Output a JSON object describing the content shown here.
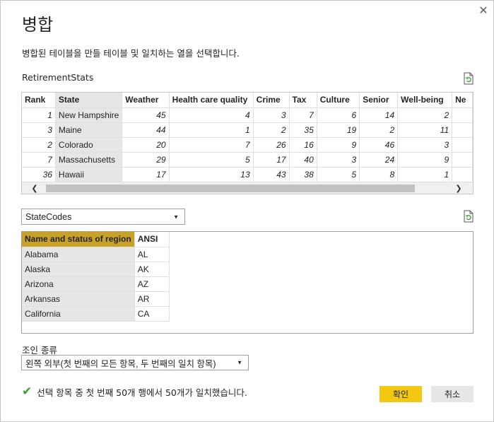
{
  "dialog": {
    "title": "병합",
    "subtitle": "병합된 테이블을 만들 테이블 및 일치하는 열을 선택합니다.",
    "close_glyph": "✕"
  },
  "table1": {
    "name": "RetirementStats",
    "columns": [
      "Rank",
      "State",
      "Weather",
      "Health care quality",
      "Crime",
      "Tax",
      "Culture",
      "Senior",
      "Well-being",
      "Ne"
    ],
    "rows": [
      [
        "1",
        "New Hampshire",
        "45",
        "4",
        "3",
        "7",
        "6",
        "14",
        "2",
        ""
      ],
      [
        "3",
        "Maine",
        "44",
        "1",
        "2",
        "35",
        "19",
        "2",
        "11",
        ""
      ],
      [
        "2",
        "Colorado",
        "20",
        "7",
        "26",
        "16",
        "9",
        "46",
        "3",
        ""
      ],
      [
        "7",
        "Massachusetts",
        "29",
        "5",
        "17",
        "40",
        "3",
        "24",
        "9",
        ""
      ],
      [
        "36",
        "Hawaii",
        "17",
        "13",
        "43",
        "38",
        "5",
        "8",
        "1",
        ""
      ]
    ],
    "selected_column_index": 1
  },
  "table2": {
    "selected_table": "StateCodes",
    "columns": [
      "Name and status of region",
      "ANSI"
    ],
    "rows": [
      [
        "Alabama",
        "AL"
      ],
      [
        "Alaska",
        "AK"
      ],
      [
        "Arizona",
        "AZ"
      ],
      [
        "Arkansas",
        "AR"
      ],
      [
        "California",
        "CA"
      ]
    ],
    "selected_column_index": 0
  },
  "join": {
    "label": "조인 종류",
    "selected": "왼쪽 외부(첫 번째의 모든 항목, 두 번째의 일치 항목)"
  },
  "status": {
    "message": "선택 항목 중 첫 번째 50개 행에서 50개가 일치했습니다."
  },
  "buttons": {
    "ok": "확인",
    "cancel": "취소"
  },
  "colors": {
    "accent": "#f2c811",
    "selected_header": "#c8a227",
    "selected_column": "#e6e6e6",
    "check": "#3c9a3c"
  }
}
